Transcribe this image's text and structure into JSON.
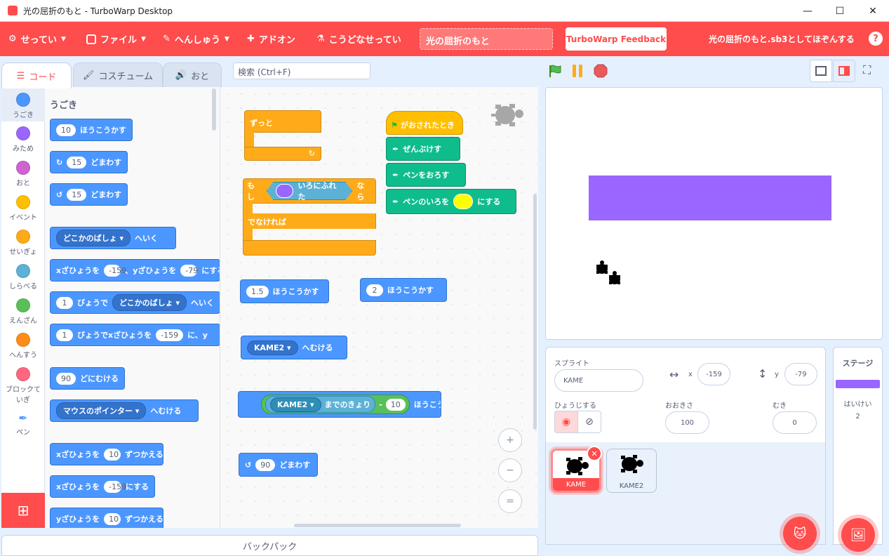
{
  "window": {
    "title": "光の屈折のもと - TurboWarp Desktop",
    "minimize": "—",
    "maximize": "☐",
    "close": "✕"
  },
  "menubar": {
    "settings": "せってい",
    "file": "ファイル",
    "edit": "へんしゅう",
    "addons": "アドオン",
    "advanced": "こうどなせってい",
    "project_title": "光の屈折のもと",
    "feedback": "TurboWarp Feedback",
    "save_as": "光の屈折のもと.sb3としてほぞんする",
    "help": "?"
  },
  "tabs": {
    "code": "コード",
    "costume": "コスチューム",
    "sound": "おと"
  },
  "search": {
    "placeholder": "検索 (Ctrl+F)"
  },
  "categories": [
    {
      "label": "うごき",
      "color": "#4c97ff"
    },
    {
      "label": "みため",
      "color": "#9966ff"
    },
    {
      "label": "おと",
      "color": "#cf63cf"
    },
    {
      "label": "イベント",
      "color": "#ffbf00"
    },
    {
      "label": "せいぎょ",
      "color": "#ffab19"
    },
    {
      "label": "しらべる",
      "color": "#5cb1d6"
    },
    {
      "label": "えんざん",
      "color": "#59c059"
    },
    {
      "label": "へんすう",
      "color": "#ff8c1a"
    },
    {
      "label": "ブロックていぎ",
      "color": "#ff6680"
    },
    {
      "label": "ペン",
      "color": "#0fbd8c"
    }
  ],
  "palette": {
    "heading": "うごき",
    "move_n": "10",
    "move": "ほうこうかす",
    "turn_r_n": "15",
    "turn": "どまわす",
    "turn_l_n": "15",
    "goto_drop": "どこかのばしょ",
    "goto": "へいく",
    "gotoxy_a": "xざひょうを",
    "gotoxy_x": "-159",
    "gotoxy_b": "、yざひょうを",
    "gotoxy_y": "-79",
    "gotoxy_c": "にする",
    "glide_n": "1",
    "glide_a": "びょうで",
    "glide_drop": "どこかのばしょ",
    "glide_b": "へいく",
    "glidexy_n": "1",
    "glidexy_a": "びょうでxざひょうを",
    "glidexy_x": "-159",
    "glidexy_b": "に、y",
    "point_n": "90",
    "point": "どにむける",
    "towards_drop": "マウスのポインター",
    "towards": "へむける",
    "changex_a": "xざひょうを",
    "changex_n": "10",
    "changex_b": "ずつかえる",
    "setx_a": "xざひょうを",
    "setx_n": "-159",
    "setx_b": "にする",
    "changey_a": "yざひょうを",
    "changey_n": "10",
    "changey_b": "ずつかえる"
  },
  "script": {
    "forever": "ずっと",
    "if": "もし",
    "touching": "いろにふれた",
    "then": "なら",
    "else": "でなければ",
    "flag": "がおされたとき",
    "clear": "ぜんぶけす",
    "pendown": "ペンをおろす",
    "setcolor": "ペンのいろを",
    "setcolor_b": "にする",
    "move1_n": "1.5",
    "move1": "ほうこうかす",
    "move2_n": "2",
    "move2": "ほうこうかす",
    "point_drop": "KAME2",
    "point": "へむける",
    "dist_drop": "KAME2",
    "dist": "までのきょり",
    "minus": "-",
    "dist_n": "10",
    "dist_move": "ほうこうかす",
    "turn_n": "90",
    "turn": "どまわす",
    "zoom_in": "+",
    "zoom_out": "−",
    "zoom_reset": "="
  },
  "stage": {
    "bar_color": "#9966ff"
  },
  "sprite_info": {
    "sprite_label": "スプライト",
    "sprite_name": "KAME",
    "x_label": "x",
    "x": "-159",
    "y_label": "y",
    "y": "-79",
    "show_label": "ひょうじする",
    "size_label": "おおきさ",
    "size": "100",
    "direction_label": "むき",
    "direction": "0"
  },
  "sprites": [
    {
      "name": "KAME"
    },
    {
      "name": "KAME2"
    }
  ],
  "stage_panel": {
    "title": "ステージ",
    "backdrops_label": "はいけい",
    "backdrops": "2"
  },
  "backpack": "バックパック"
}
